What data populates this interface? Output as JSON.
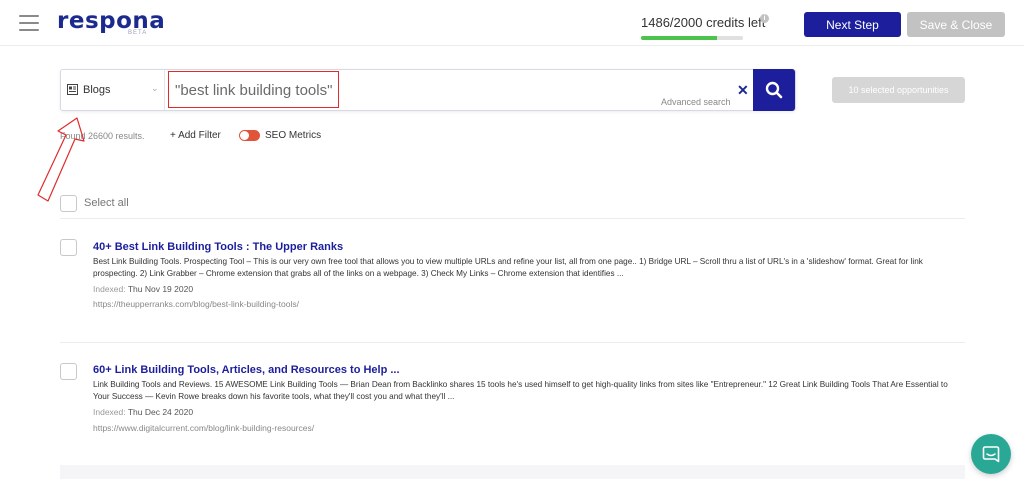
{
  "header": {
    "logo": "respona",
    "logo_badge": "BETA",
    "credits_text": "1486/2000 credits left",
    "credits_progress": 0.743,
    "next_step_label": "Next Step",
    "save_close_label": "Save & Close"
  },
  "search": {
    "type_label": "Blogs",
    "query": "\"best link building tools\"",
    "advanced_label": "Advanced search",
    "selected_opportunities_label": "10 selected opportunities"
  },
  "filters": {
    "found_text": "Found 26600 results.",
    "add_filter_label": "+ Add Filter",
    "seo_metrics_label": "SEO Metrics"
  },
  "select_all_label": "Select all",
  "results": [
    {
      "title": "40+ Best Link Building Tools : The Upper Ranks",
      "snippet": "Best Link Building Tools. Prospecting Tool – This is our very own free tool that allows you to view multiple URLs and refine your list, all from one page.. 1) Bridge URL – Scroll thru a list of URL's in a 'slideshow' format. Great for link prospecting. 2) Link Grabber – Chrome extension that grabs all of the links on a webpage. 3) Check My Links – Chrome extension that identifies ...",
      "indexed_label": "Indexed:",
      "indexed_date": "Thu Nov 19 2020",
      "url": "https://theupperranks.com/blog/best-link-building-tools/"
    },
    {
      "title": "60+ Link Building Tools, Articles, and Resources to Help ...",
      "snippet": "Link Building Tools and Reviews. 15 AWESOME Link Building Tools — Brian Dean from Backlinko shares 15 tools he's used himself to get high-quality links from sites like \"Entrepreneur.\" 12 Great Link Building Tools That Are Essential to Your Success — Kevin Rowe breaks down his favorite tools, what they'll cost you and what they'll ...",
      "indexed_label": "Indexed:",
      "indexed_date": "Thu Dec 24 2020",
      "url": "https://www.digitalcurrent.com/blog/link-building-resources/"
    }
  ],
  "colors": {
    "brand": "#1c1e9c",
    "progress": "#4cc34a",
    "toggle": "#e0553a",
    "annotation": "#e02b2b",
    "chat": "#2aa896"
  }
}
